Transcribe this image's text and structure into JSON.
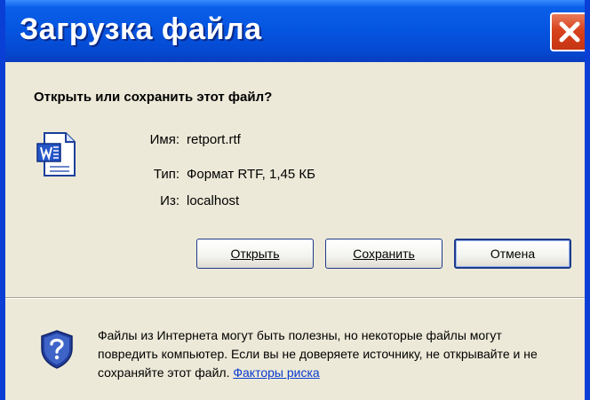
{
  "window": {
    "title": "Загрузка файла"
  },
  "dialog": {
    "question": "Открыть или сохранить этот файл?",
    "file": {
      "icon": "word-document-icon",
      "name_label": "Имя:",
      "name_value": "retport.rtf",
      "type_label": "Тип:",
      "type_value": "Формат RTF, 1,45 КБ",
      "from_label": "Из:",
      "from_value": "localhost"
    },
    "buttons": {
      "open": "Открыть",
      "save": "Сохранить",
      "cancel": "Отмена"
    },
    "warning": {
      "icon": "shield-question-icon",
      "text": "Файлы из Интернета могут быть полезны, но некоторые файлы могут повредить компьютер. Если вы не доверяете источнику, не открывайте и не сохраняйте этот файл.",
      "link": "Факторы риска"
    }
  },
  "colors": {
    "titlebar": "#0554e0",
    "window_body": "#ece9d8",
    "close_button": "#d8421c",
    "link": "#0a3acf"
  }
}
